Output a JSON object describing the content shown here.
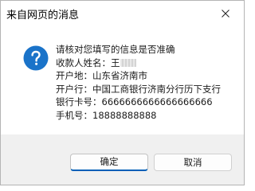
{
  "dialog": {
    "title": "来自网页的消息",
    "icon": "question-icon",
    "message": {
      "line1": "请核对您填写的信息是否准确",
      "name_label": "收款人姓名：",
      "name_value": "王",
      "city_label": "开户地：",
      "city_value": "山东省济南市",
      "bank_label": "开户行：",
      "bank_value": "中国工商银行济南分行历下支行",
      "card_label": "银行卡号：",
      "card_value": "6666666666666666666",
      "phone_label": "手机号：",
      "phone_value": "18888888888"
    },
    "buttons": {
      "ok": "确定",
      "cancel": "取消"
    }
  },
  "colors": {
    "icon_blue": "#1a73c9",
    "ok_accent": "#005fb8",
    "footer_bg": "#f0f0f0"
  }
}
